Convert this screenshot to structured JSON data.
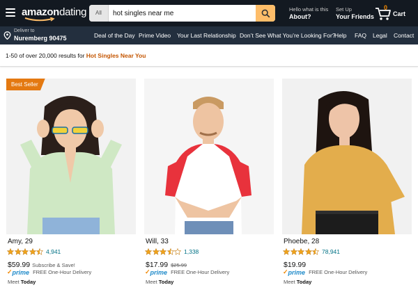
{
  "header": {
    "logo": {
      "word1": "amazon",
      "word2": "dating"
    },
    "search": {
      "category": "All",
      "query": "hot singles near me"
    },
    "help": {
      "line1": "Hello what is this",
      "line2": "About?"
    },
    "setup": {
      "line1": "Set Up",
      "line2": "Your Friends"
    },
    "cart": {
      "count": "0",
      "label": "Cart"
    }
  },
  "subnav": {
    "deliver": {
      "line1": "Deliver to",
      "line2": "Nuremberg 90475"
    },
    "items": [
      "Deal of the Day",
      "Prime Video",
      "Your Last Relationship",
      "Don’t See What You’re Looking For?",
      "Help",
      "FAQ",
      "Legal",
      "Contact"
    ]
  },
  "results": {
    "count_text": "1-50 of over 20,000 results for ",
    "query": "Hot Singles Near You"
  },
  "products": [
    {
      "badge": "Best Seller",
      "name": "Amy, 29",
      "rating": 4.5,
      "reviews": "4,941",
      "price": "$59.99",
      "price_note": "Subscribe & Save!",
      "old_price": "",
      "prime_check": "✓",
      "prime_word": "prime",
      "delivery": "FREE One-Hour Delivery",
      "meet_prefix": "Meet ",
      "meet_day": "Today",
      "shirt_color": "#cfe8c4",
      "pants_color": "#8fb3d9",
      "hair_color": "#2b1f1a"
    },
    {
      "badge": "",
      "name": "Will, 33",
      "rating": 3.5,
      "reviews": "1,338",
      "price": "$17.99",
      "price_note": "",
      "old_price": "$25.99",
      "prime_check": "✓",
      "prime_word": "prime",
      "delivery": "FREE One-Hour Delivery",
      "meet_prefix": "Meet ",
      "meet_day": "Today",
      "shirt_color": "#e8323c",
      "pants_color": "#6e8fb8",
      "hair_color": "#c99a62"
    },
    {
      "badge": "",
      "name": "Phoebe, 28",
      "rating": 4.5,
      "reviews": "78,941",
      "price": "$19.99",
      "price_note": "",
      "old_price": "",
      "prime_check": "✓",
      "prime_word": "prime",
      "delivery": "FREE One-Hour Delivery",
      "meet_prefix": "Meet ",
      "meet_day": "Today",
      "shirt_color": "#e3ad4c",
      "pants_color": "#1c1c1c",
      "hair_color": "#1e1410"
    }
  ],
  "colors": {
    "nav_dark": "#131921",
    "nav_sub": "#232f3e",
    "search_button": "#febd69",
    "badge": "#e47911",
    "star": "#f0a41b",
    "link": "#007185",
    "query_orange": "#c45500"
  }
}
